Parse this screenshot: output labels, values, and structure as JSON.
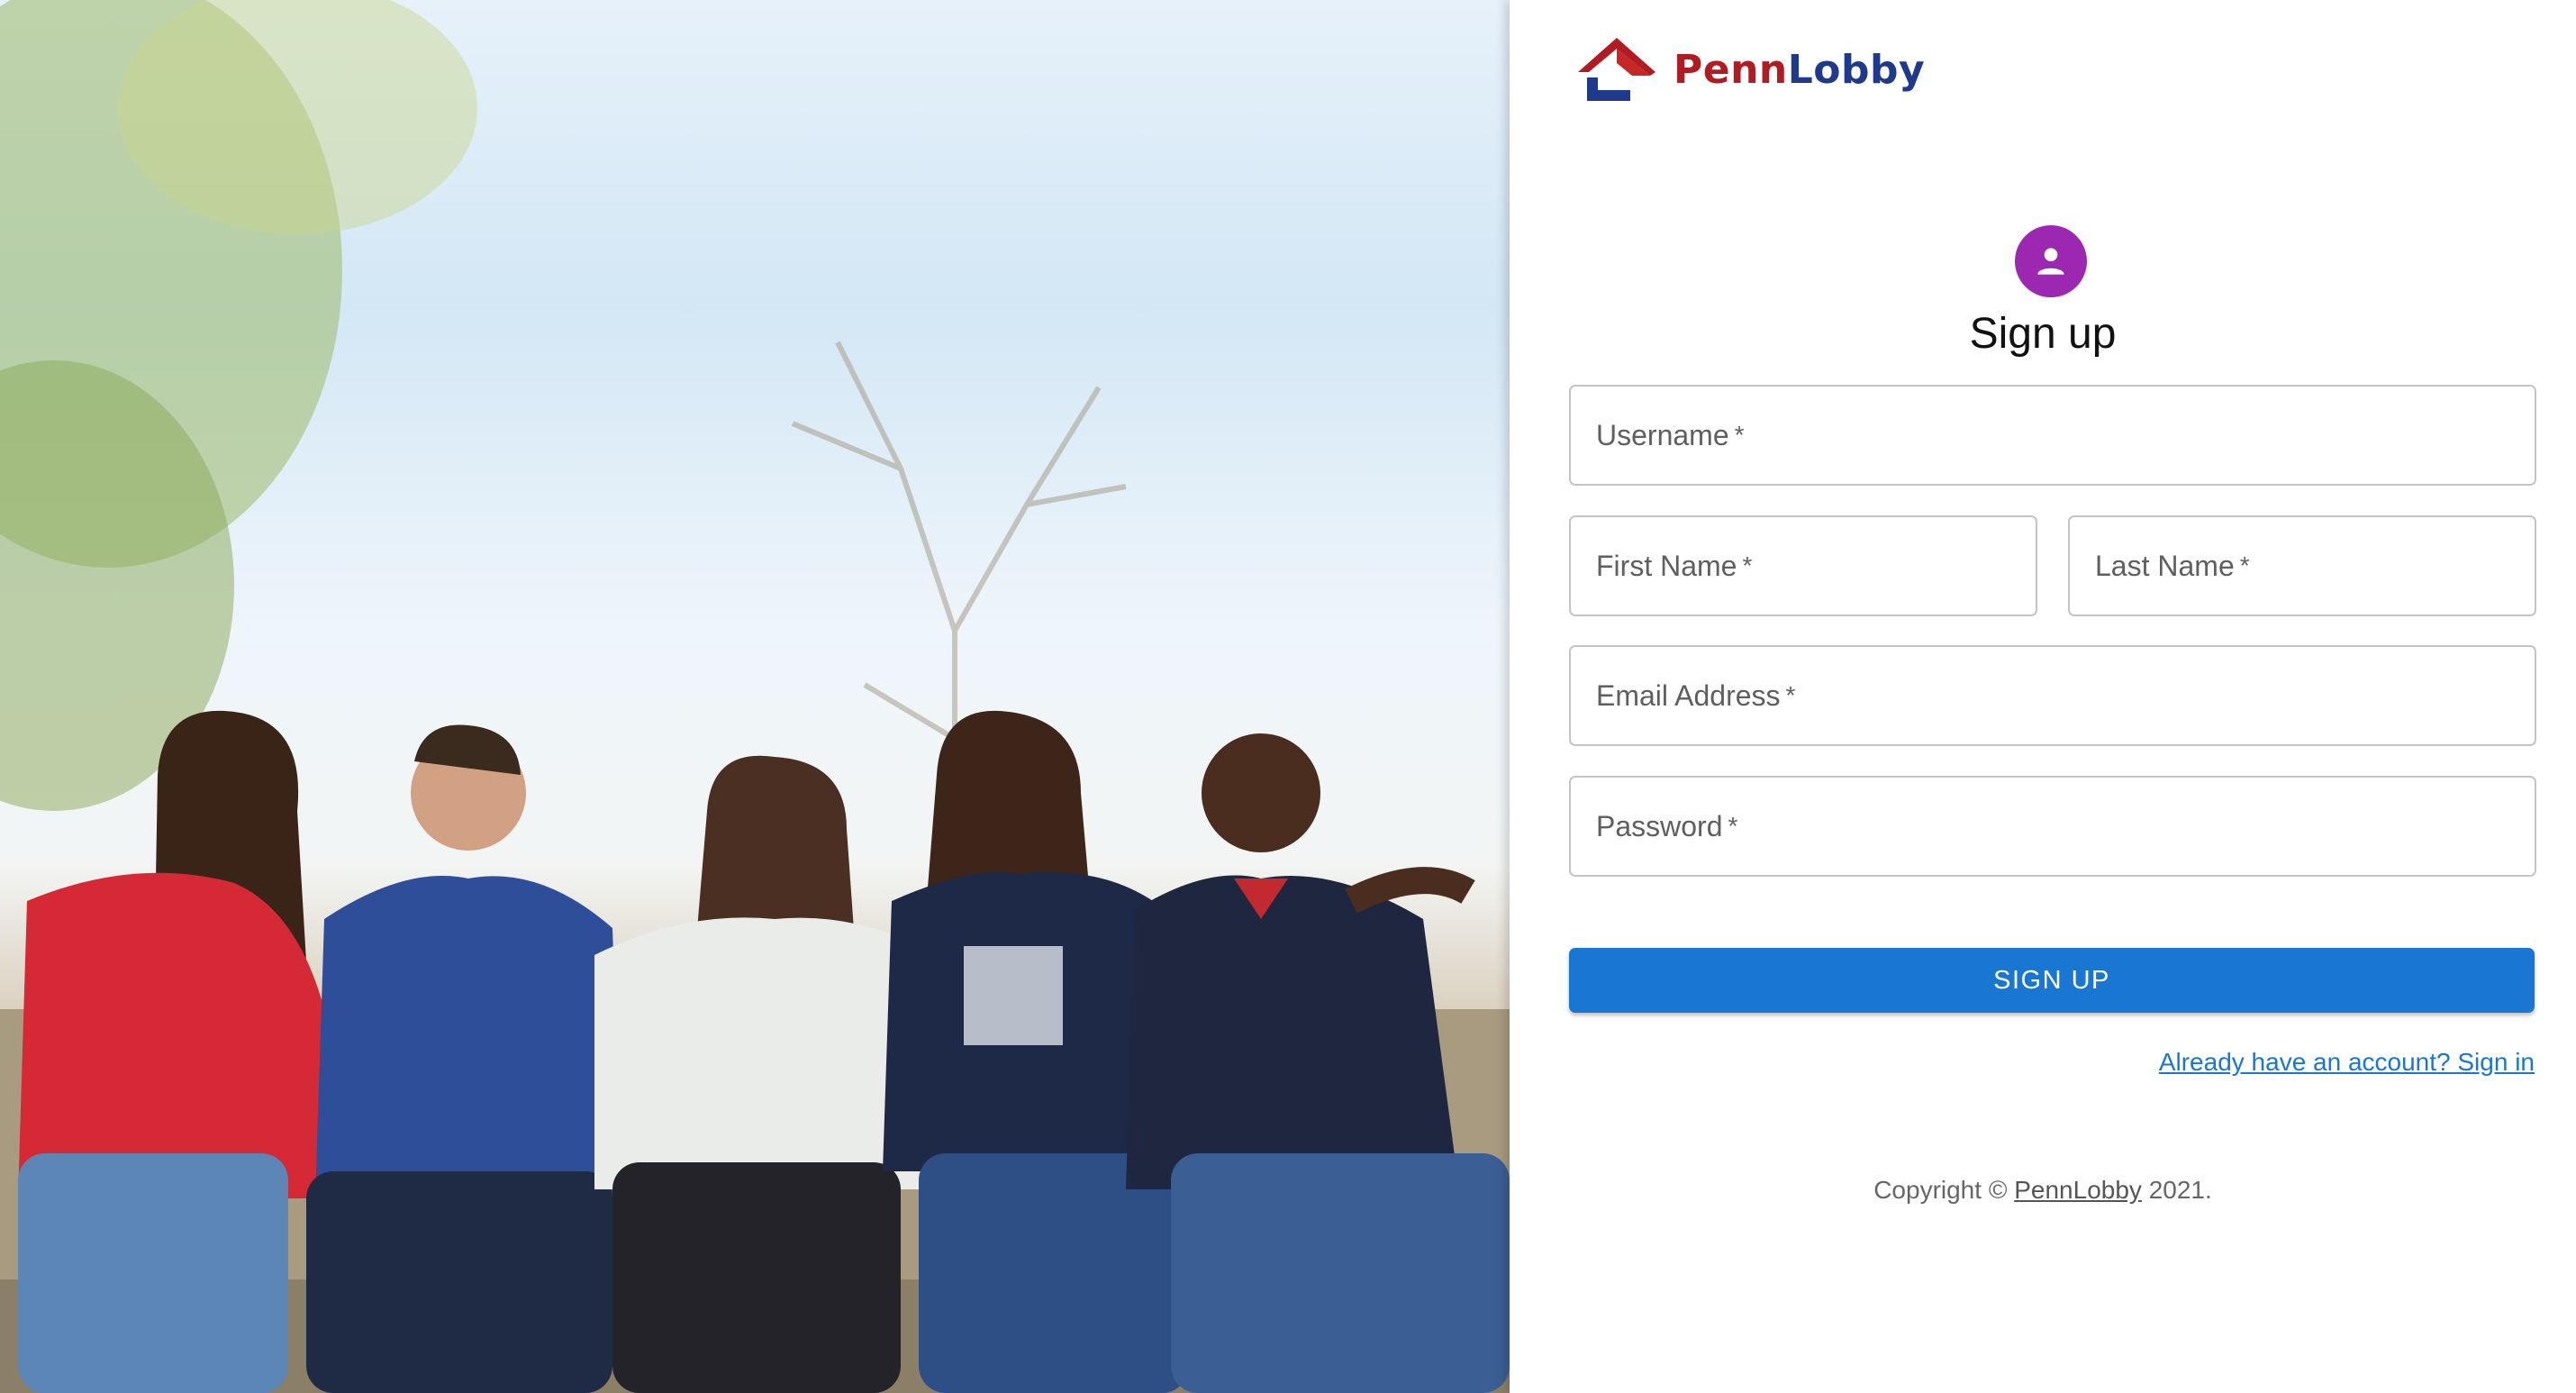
{
  "brand": {
    "name_part1": "Penn",
    "name_part2": "Lobby"
  },
  "form": {
    "title": "Sign up",
    "username_label": "Username",
    "first_name_label": "First Name",
    "last_name_label": "Last Name",
    "email_label": "Email Address",
    "password_label": "Password",
    "required_marker": "*",
    "submit_label": "SIGN UP",
    "signin_link": "Already have an account? Sign in"
  },
  "footer": {
    "prefix": "Copyright © ",
    "link": "PennLobby",
    "suffix": " 2021."
  },
  "colors": {
    "avatar": "#9c27b0",
    "button": "#1976d2",
    "brand_red": "#b01c22",
    "brand_blue": "#1f3a8c"
  },
  "icons": {
    "avatar_icon": "person-icon",
    "logo_icon": "house-icon"
  }
}
